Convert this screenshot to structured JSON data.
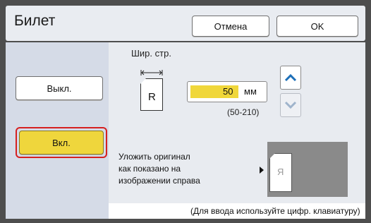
{
  "window": {
    "title": "Билет",
    "cancel_label": "Отмена",
    "ok_label": "OK"
  },
  "mode": {
    "off_label": "Выкл.",
    "on_label": "Вкл.",
    "selected": "Вкл."
  },
  "width": {
    "label": "Шир. стр.",
    "page_letter": "R",
    "value": "50",
    "unit": "мм",
    "range": "(50-210)",
    "up_icon": "chevron-up-icon",
    "down_icon": "chevron-down-icon"
  },
  "placement": {
    "instruction_line1": "Уложить оригинал",
    "instruction_line2": "как показано на",
    "instruction_line3": "изображении справа",
    "preview_letter": "Я"
  },
  "footer_hint": "(Для ввода используйте цифр. клавиатуру)",
  "colors": {
    "selected_fill": "#efd63c",
    "selected_outline": "#d62020",
    "accent_blue": "#1d6fb8"
  }
}
